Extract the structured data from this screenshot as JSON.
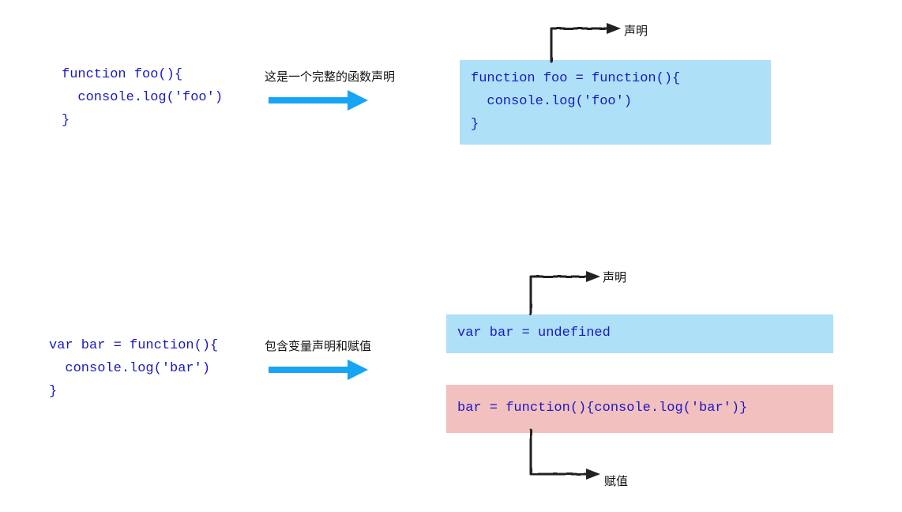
{
  "example1": {
    "source_code": "function foo(){\n  console.log('foo')\n}",
    "annotation": "这是一个完整的函数声明",
    "result_code": "function foo = function(){\n  console.log('foo')\n}",
    "label_declaration": "声明"
  },
  "example2": {
    "source_code": "var bar = function(){\n  console.log('bar')\n}",
    "annotation": "包含变量声明和赋值",
    "result_declaration_code": "var bar = undefined",
    "result_assignment_code": "bar = function(){console.log('bar')}",
    "label_declaration": "声明",
    "label_assignment": "赋值"
  },
  "colors": {
    "code_text": "#1919c1",
    "arrow_blue": "#17a4f5",
    "box_blue_bg": "#aee0f8",
    "box_red_bg": "#f3c0c0",
    "sketch_black": "#222222"
  }
}
